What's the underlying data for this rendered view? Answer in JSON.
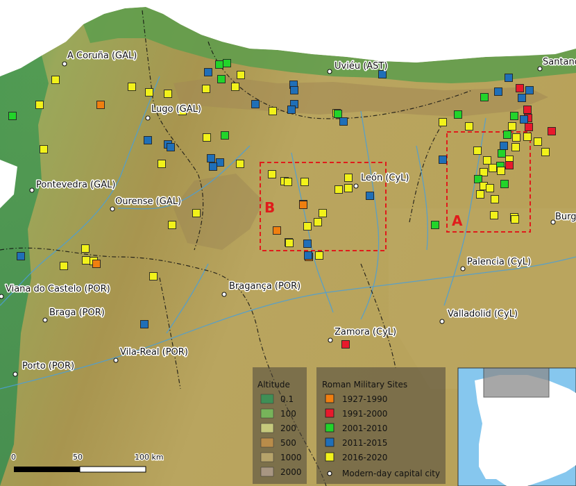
{
  "cities": [
    {
      "name": "A Coruña (GAL)"
    },
    {
      "name": "Uviéu (AST)"
    },
    {
      "name": "Santander (CAN)"
    },
    {
      "name": "Lugo (GAL)"
    },
    {
      "name": "León (CyL)"
    },
    {
      "name": "Pontevedra (GAL)"
    },
    {
      "name": "Ourense (GAL)"
    },
    {
      "name": "Burgos (CyL)"
    },
    {
      "name": "Palencia (CyL)"
    },
    {
      "name": "Viana do Castelo (POR)"
    },
    {
      "name": "Bragança (POR)"
    },
    {
      "name": "Braga (POR)"
    },
    {
      "name": "Valladolid (CyL)"
    },
    {
      "name": "Zamora (CyL)"
    },
    {
      "name": "Vila-Real (POR)"
    },
    {
      "name": "Porto (POR)"
    }
  ],
  "study_areas": [
    {
      "label": "A"
    },
    {
      "label": "B"
    }
  ],
  "legend": {
    "altitude_title": "Altitude",
    "altitude_classes": [
      {
        "label": "0.1",
        "color": "#3f8f56"
      },
      {
        "label": "100",
        "color": "#77b35a"
      },
      {
        "label": "200",
        "color": "#c6c97c"
      },
      {
        "label": "500",
        "color": "#b98c4a"
      },
      {
        "label": "1000",
        "color": "#b6a36a"
      },
      {
        "label": "2000",
        "color": "#a89682"
      }
    ],
    "sites_title": "Roman Military Sites",
    "site_classes": [
      {
        "label": "1927-1990",
        "color": "#f07f10"
      },
      {
        "label": "1991-2000",
        "color": "#e8192c"
      },
      {
        "label": "2001-2010",
        "color": "#22d42a"
      },
      {
        "label": "2011-2015",
        "color": "#1f6fb8"
      },
      {
        "label": "2016-2020",
        "color": "#f2f21a"
      }
    ],
    "capital_label": "Modern-day capital city"
  },
  "scale_bar": {
    "labels": [
      "0",
      "50",
      "100 km"
    ]
  },
  "colors": {
    "sea": "#ffffff",
    "lowland": "#3e8f52",
    "plateau": "#b7a45c",
    "study_box": "#e01b1b"
  }
}
